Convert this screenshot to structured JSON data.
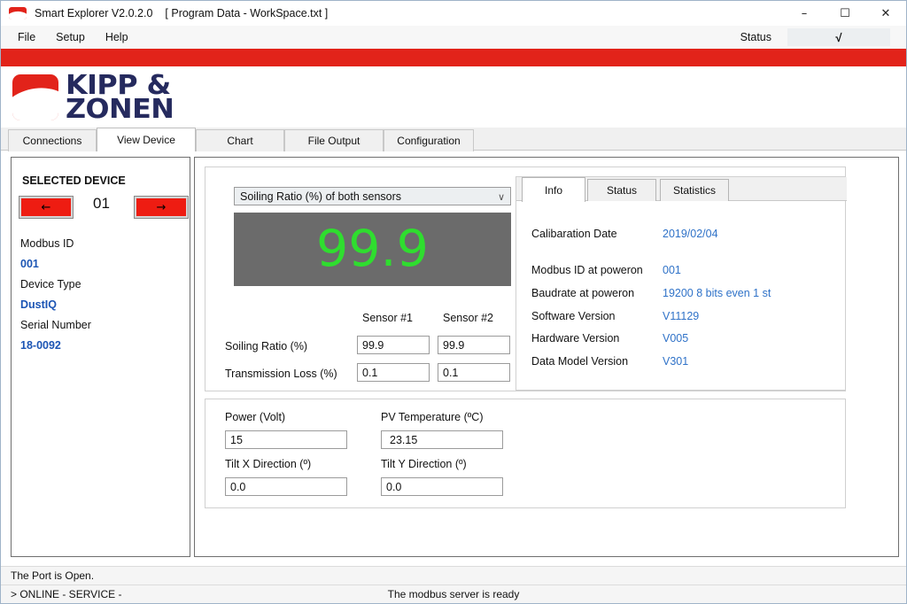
{
  "window": {
    "app_title": "Smart Explorer V2.0.2.0",
    "document_title": "[ Program Data - WorkSpace.txt ]",
    "minimize": "–",
    "maximize": "☐",
    "close": "✕",
    "logo_icon": "kipp-zonen-mark"
  },
  "menubar": {
    "items": [
      {
        "label": "File"
      },
      {
        "label": "Setup"
      },
      {
        "label": "Help"
      }
    ],
    "status_label": "Status",
    "status_value": "√"
  },
  "brand": {
    "line1": "KIPP &",
    "line2": "ZONEN",
    "mark_color": "#e2231a",
    "text_color": "#252a5e",
    "banner_color": "#e2231a"
  },
  "tabs": [
    {
      "label": "Connections",
      "active": false
    },
    {
      "label": "View Device",
      "active": true
    },
    {
      "label": "Chart",
      "active": false
    },
    {
      "label": "File Output",
      "active": false
    },
    {
      "label": "Configuration",
      "active": false
    }
  ],
  "sidebar": {
    "title": "SELECTED DEVICE",
    "prev_arrow": "←",
    "next_arrow": "→",
    "device_number": "01",
    "fields": [
      {
        "label": "Modbus ID",
        "value": "001"
      },
      {
        "label": "Device Type",
        "value": "DustIQ"
      },
      {
        "label": "Serial Number",
        "value": "18-0092"
      }
    ],
    "value_color": "#1c55b4",
    "button_color": "#ee1c12"
  },
  "measurement": {
    "selector_value": "Soiling Ratio (%) of both sensors",
    "selector_arrow": "∨",
    "big_value": "99.9",
    "big_value_color": "#2fdd2f",
    "display_bg": "#6b6b6b",
    "column_headers": [
      "Sensor #1",
      "Sensor #2"
    ],
    "rows": [
      {
        "label": "Soiling Ratio (%)",
        "sensor1": "99.9",
        "sensor2": "99.9"
      },
      {
        "label": "Transmission Loss (%)",
        "sensor1": "0.1",
        "sensor2": "0.1"
      }
    ]
  },
  "info_panel": {
    "tabs": [
      {
        "label": "Info",
        "active": true
      },
      {
        "label": "Status",
        "active": false
      },
      {
        "label": "Statistics",
        "active": false
      }
    ],
    "rows": [
      {
        "key": "Calibaration Date",
        "value": "2019/02/04"
      },
      {
        "key": "Modbus ID at poweron",
        "value": "001"
      },
      {
        "key": "Baudrate at poweron",
        "value": "19200 8 bits even 1 st"
      },
      {
        "key": "Software Version",
        "value": "V11129"
      },
      {
        "key": "Hardware Version",
        "value": "V005"
      },
      {
        "key": "Data Model Version",
        "value": "V301"
      }
    ],
    "value_color": "#2f72c8"
  },
  "device_readings": {
    "power_label": "Power (Volt)",
    "power_value": "15",
    "pv_temp_label": "PV Temperature (ºC)",
    "pv_temp_value": "23.15",
    "tilt_x_label": "Tilt X Direction (º)",
    "tilt_x_value": "0.0",
    "tilt_y_label": "Tilt Y Direction  (º)",
    "tilt_y_value": "0.0"
  },
  "statusbar": {
    "line1": "The Port is Open.",
    "line2_left": "> ONLINE  - SERVICE -",
    "line2_center": "The modbus server is ready"
  }
}
